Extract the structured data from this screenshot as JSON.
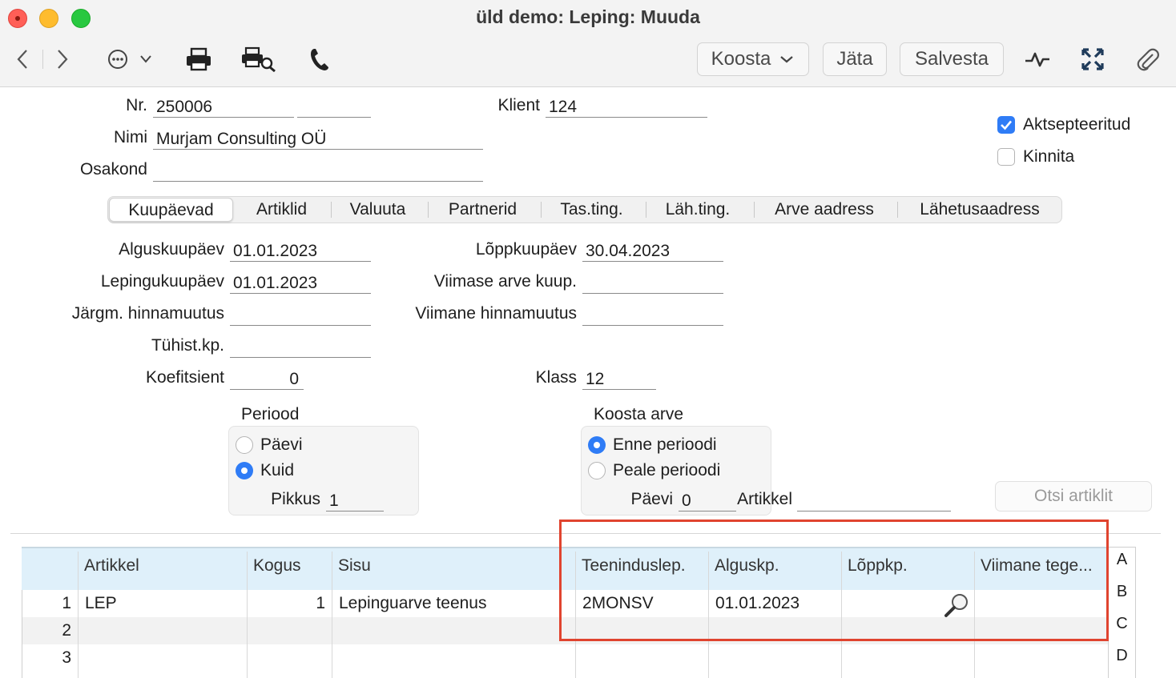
{
  "window": {
    "title": "üld demo: Leping: Muuda"
  },
  "toolbar": {
    "koosta_label": "Koosta",
    "jata_label": "Jäta",
    "salvesta_label": "Salvesta"
  },
  "header": {
    "nr_label": "Nr.",
    "nr_value": "250006",
    "nr_extra_value": "",
    "klient_label": "Klient",
    "klient_value": "124",
    "nimi_label": "Nimi",
    "nimi_value": "Murjam Consulting OÜ",
    "osakond_label": "Osakond",
    "osakond_value": "",
    "aktsepteeritud_label": "Aktsepteeritud",
    "aktsepteeritud_checked": true,
    "kinnita_label": "Kinnita",
    "kinnita_checked": false
  },
  "tabs": [
    {
      "label": "Kuupäevad",
      "active": true
    },
    {
      "label": "Artiklid",
      "active": false
    },
    {
      "label": "Valuuta",
      "active": false
    },
    {
      "label": "Partnerid",
      "active": false
    },
    {
      "label": "Tas.ting.",
      "active": false
    },
    {
      "label": "Läh.ting.",
      "active": false
    },
    {
      "label": "Arve aadress",
      "active": false
    },
    {
      "label": "Lähetusaadress",
      "active": false
    }
  ],
  "dates": {
    "alguskuupaev_label": "Alguskuupäev",
    "alguskuupaev_value": "01.01.2023",
    "loppkuupaev_label": "Lõppkuupäev",
    "loppkuupaev_value": "30.04.2023",
    "lepingukuupaev_label": "Lepingukuupäev",
    "lepingukuupaev_value": "01.01.2023",
    "viimase_arve_label": "Viimase arve kuup.",
    "viimase_arve_value": "",
    "jargm_hinnamuutus_label": "Järgm. hinnamuutus",
    "jargm_hinnamuutus_value": "",
    "viimane_hinnamuutus_label": "Viimane hinnamuutus",
    "viimane_hinnamuutus_value": "",
    "tuhist_label": "Tühist.kp.",
    "tuhist_value": "",
    "koefitsient_label": "Koefitsient",
    "koefitsient_value": "0",
    "klass_label": "Klass",
    "klass_value": "12"
  },
  "periood": {
    "title": "Periood",
    "option_paevi": "Päevi",
    "option_kuid": "Kuid",
    "selected": "Kuid",
    "pikkus_label": "Pikkus",
    "pikkus_value": "1"
  },
  "koosta_arve": {
    "title": "Koosta arve",
    "option_enne": "Enne perioodi",
    "option_peale": "Peale perioodi",
    "selected": "Enne perioodi",
    "paevi_label": "Päevi",
    "paevi_value": "0",
    "artikkel_label": "Artikkel",
    "artikkel_value": ""
  },
  "otsi_artiklit_label": "Otsi artiklit",
  "table": {
    "columns": [
      "",
      "Artikkel",
      "Kogus",
      "Sisu",
      "Teeninduslep.",
      "Alguskp.",
      "Lõppkp.",
      "Viimane tege..."
    ],
    "rows": [
      {
        "num": "1",
        "artikkel": "LEP",
        "kogus": "1",
        "sisu": "Lepinguarve teenus",
        "teeninduslep": "2MONSV",
        "alguskp": "01.01.2023",
        "loppkp": "",
        "viimane": ""
      },
      {
        "num": "2",
        "artikkel": "",
        "kogus": "",
        "sisu": "",
        "teeninduslep": "",
        "alguskp": "",
        "loppkp": "",
        "viimane": ""
      },
      {
        "num": "3",
        "artikkel": "",
        "kogus": "",
        "sisu": "",
        "teeninduslep": "",
        "alguskp": "",
        "loppkp": "",
        "viimane": ""
      }
    ],
    "side_letters": [
      "A",
      "B",
      "C",
      "D"
    ]
  },
  "colors": {
    "accent": "#2f7cf6",
    "header_bg": "#dff0fa",
    "highlight_border": "#e0442f"
  },
  "icons": [
    "back-icon",
    "forward-icon",
    "more-icon",
    "print-icon",
    "print-preview-icon",
    "phone-icon",
    "chart-icon",
    "expand-icon",
    "attachment-icon",
    "magnifier-icon"
  ]
}
